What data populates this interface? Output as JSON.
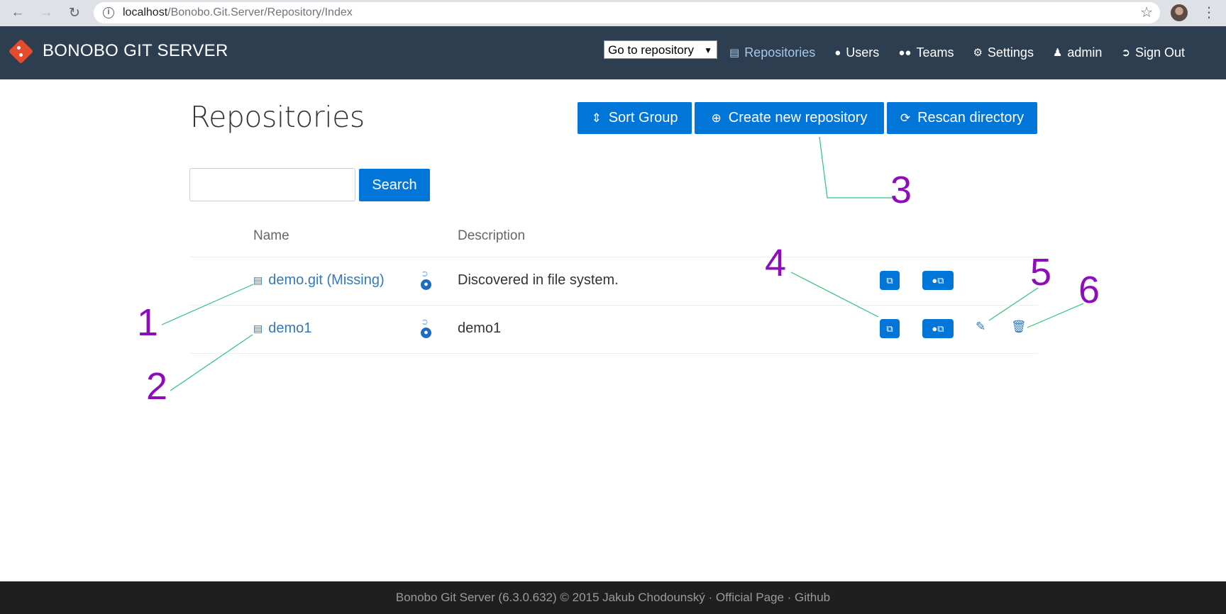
{
  "browser": {
    "url_host": "localhost",
    "url_path": "/Bonobo.Git.Server/Repository/Index",
    "back_icon": "arrow-left-icon",
    "forward_icon": "arrow-right-icon",
    "reload_icon": "reload-icon"
  },
  "navbar": {
    "brand": "BONOBO GIT SERVER",
    "goto_select": "Go to repository",
    "links": [
      {
        "label": "Repositories",
        "icon": "drive-icon"
      },
      {
        "label": "Users",
        "icon": "user-icon"
      },
      {
        "label": "Teams",
        "icon": "team-icon"
      },
      {
        "label": "Settings",
        "icon": "gears-icon"
      },
      {
        "label": "admin",
        "icon": "person-icon"
      },
      {
        "label": "Sign Out",
        "icon": "signout-icon"
      }
    ],
    "background": "#2c3e50"
  },
  "main": {
    "title": "Repositories",
    "buttons": {
      "sort": "Sort Group",
      "create": "Create new repository",
      "rescan": "Rescan directory"
    },
    "search": {
      "placeholder": "",
      "button": "Search"
    },
    "table": {
      "headers": {
        "name": "Name",
        "description": "Description"
      },
      "rows": [
        {
          "name": "demo.git (Missing)",
          "description": "Discovered in file system."
        },
        {
          "name": "demo1",
          "description": "demo1"
        }
      ]
    },
    "accent": "#0275d8"
  },
  "annotations": [
    "1",
    "2",
    "3",
    "4",
    "5",
    "6"
  ],
  "footer": {
    "text": "Bonobo Git Server (6.3.0.632) © 2015 Jakub Chodounský · Official Page · Github"
  }
}
